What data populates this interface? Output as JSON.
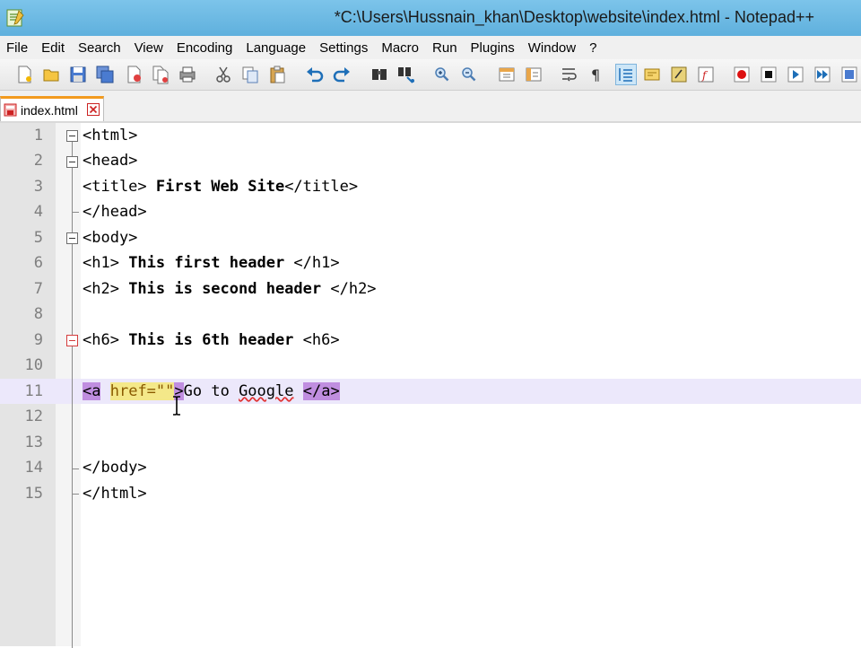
{
  "window": {
    "title": "*C:\\Users\\Hussnain_khan\\Desktop\\website\\index.html - Notepad++"
  },
  "menu": [
    "File",
    "Edit",
    "Search",
    "View",
    "Encoding",
    "Language",
    "Settings",
    "Macro",
    "Run",
    "Plugins",
    "Window",
    "?"
  ],
  "toolbar": {
    "icons": [
      "new-file-icon",
      "open-file-icon",
      "save-icon",
      "save-all-icon",
      "close-icon",
      "close-all-icon",
      "print-icon",
      "cut-icon",
      "copy-icon",
      "paste-icon",
      "undo-icon",
      "redo-icon",
      "find-icon",
      "replace-icon",
      "zoom-in-icon",
      "zoom-out-icon",
      "sync-vertical-icon",
      "sync-horizontal-icon",
      "word-wrap-icon",
      "show-all-chars-icon",
      "indent-guide-icon",
      "doc-map-icon",
      "user-language-icon",
      "function-list-icon",
      "record-macro-icon",
      "stop-record-icon",
      "play-macro-icon",
      "run-macro-multiple-icon",
      "save-macro-icon"
    ]
  },
  "tabs": [
    {
      "label": "index.html",
      "status": "modified"
    }
  ],
  "editor": {
    "current_line": 11,
    "lines": [
      {
        "num": "1",
        "text": "<html>"
      },
      {
        "num": "2",
        "text": "<head>"
      },
      {
        "num": "3",
        "tag_open": "<title>",
        "content": " First Web Site",
        "tag_close": "</title>"
      },
      {
        "num": "4",
        "text": "</head>"
      },
      {
        "num": "5",
        "text": "<body>"
      },
      {
        "num": "6",
        "tag_open": "<h1>",
        "content": " This first header ",
        "tag_close": "</h1>"
      },
      {
        "num": "7",
        "tag_open": "<h2>",
        "content": " This is second header ",
        "tag_close": "</h2>"
      },
      {
        "num": "8",
        "text": ""
      },
      {
        "num": "9",
        "tag_open": "<h6>",
        "content": " This is 6th header ",
        "tag_close": "<h6>"
      },
      {
        "num": "10",
        "text": ""
      },
      {
        "num": "11",
        "a_open": "<a",
        "a_space": " ",
        "attr": "href=\"\"",
        "a_gt": ">",
        "t1": "Go to ",
        "t2": "Google",
        "t3": " ",
        "a_close": "</a>"
      },
      {
        "num": "12",
        "text": ""
      },
      {
        "num": "13",
        "text": ""
      },
      {
        "num": "14",
        "text": "</body>"
      },
      {
        "num": "15",
        "text": "</html>"
      }
    ]
  }
}
